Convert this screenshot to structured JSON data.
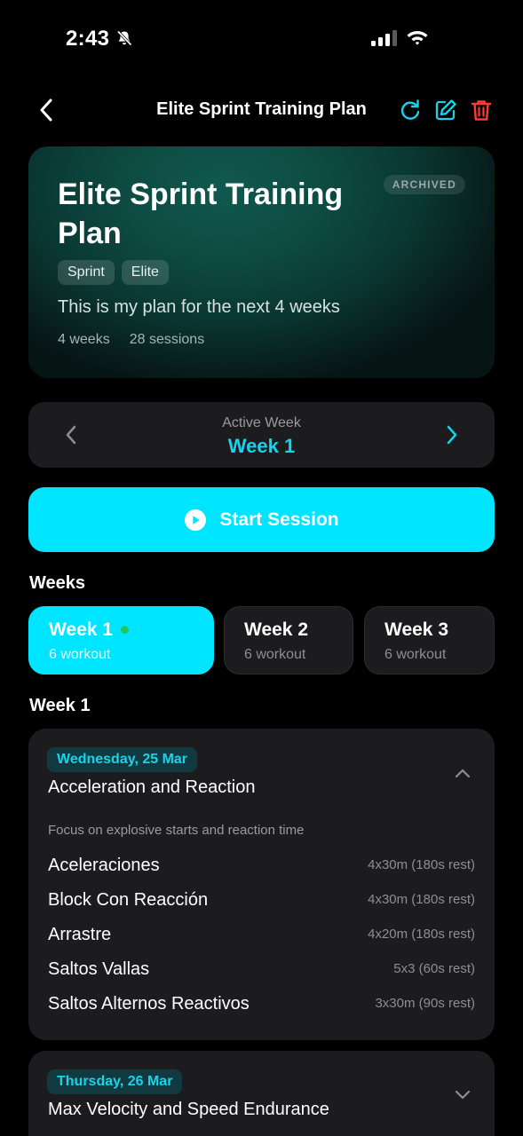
{
  "status_bar": {
    "time": "2:43"
  },
  "header": {
    "title": "Elite Sprint Training Plan"
  },
  "hero": {
    "title": "Elite Sprint Training Plan",
    "badge": "ARCHIVED",
    "tags": [
      "Sprint",
      "Elite"
    ],
    "description": "This is my plan for the next 4 weeks",
    "weeks_count": "4 weeks",
    "sessions_count": "28 sessions"
  },
  "active_week": {
    "label": "Active Week",
    "value": "Week 1"
  },
  "start_button": {
    "label": "Start Session"
  },
  "weeks_section": {
    "title": "Weeks",
    "items": [
      {
        "name": "Week 1",
        "sub": "6 workout",
        "active": true
      },
      {
        "name": "Week 2",
        "sub": "6 workout",
        "active": false
      },
      {
        "name": "Week 3",
        "sub": "6 workout",
        "active": false
      }
    ]
  },
  "week_detail": {
    "title": "Week 1",
    "days": [
      {
        "date": "Wednesday, 25 Mar",
        "title": "Acceleration and Reaction",
        "expanded": true,
        "focus": "Focus on explosive starts and reaction time",
        "exercises": [
          {
            "name": "Aceleraciones",
            "detail": "4x30m (180s rest)"
          },
          {
            "name": "Block Con Reacción",
            "detail": "4x30m (180s rest)"
          },
          {
            "name": "Arrastre",
            "detail": "4x20m (180s rest)"
          },
          {
            "name": "Saltos Vallas",
            "detail": "5x3 (60s rest)"
          },
          {
            "name": "Saltos Alternos Reactivos",
            "detail": "3x30m (90s rest)"
          }
        ]
      },
      {
        "date": "Thursday, 26 Mar",
        "title": "Max Velocity and Speed Endurance",
        "expanded": false
      }
    ]
  },
  "colors": {
    "accent": "#00e5ff",
    "accent_text": "#19d3ea",
    "danger": "#ff3b30",
    "card": "#1c1c1e",
    "live_dot": "#22c55e"
  }
}
